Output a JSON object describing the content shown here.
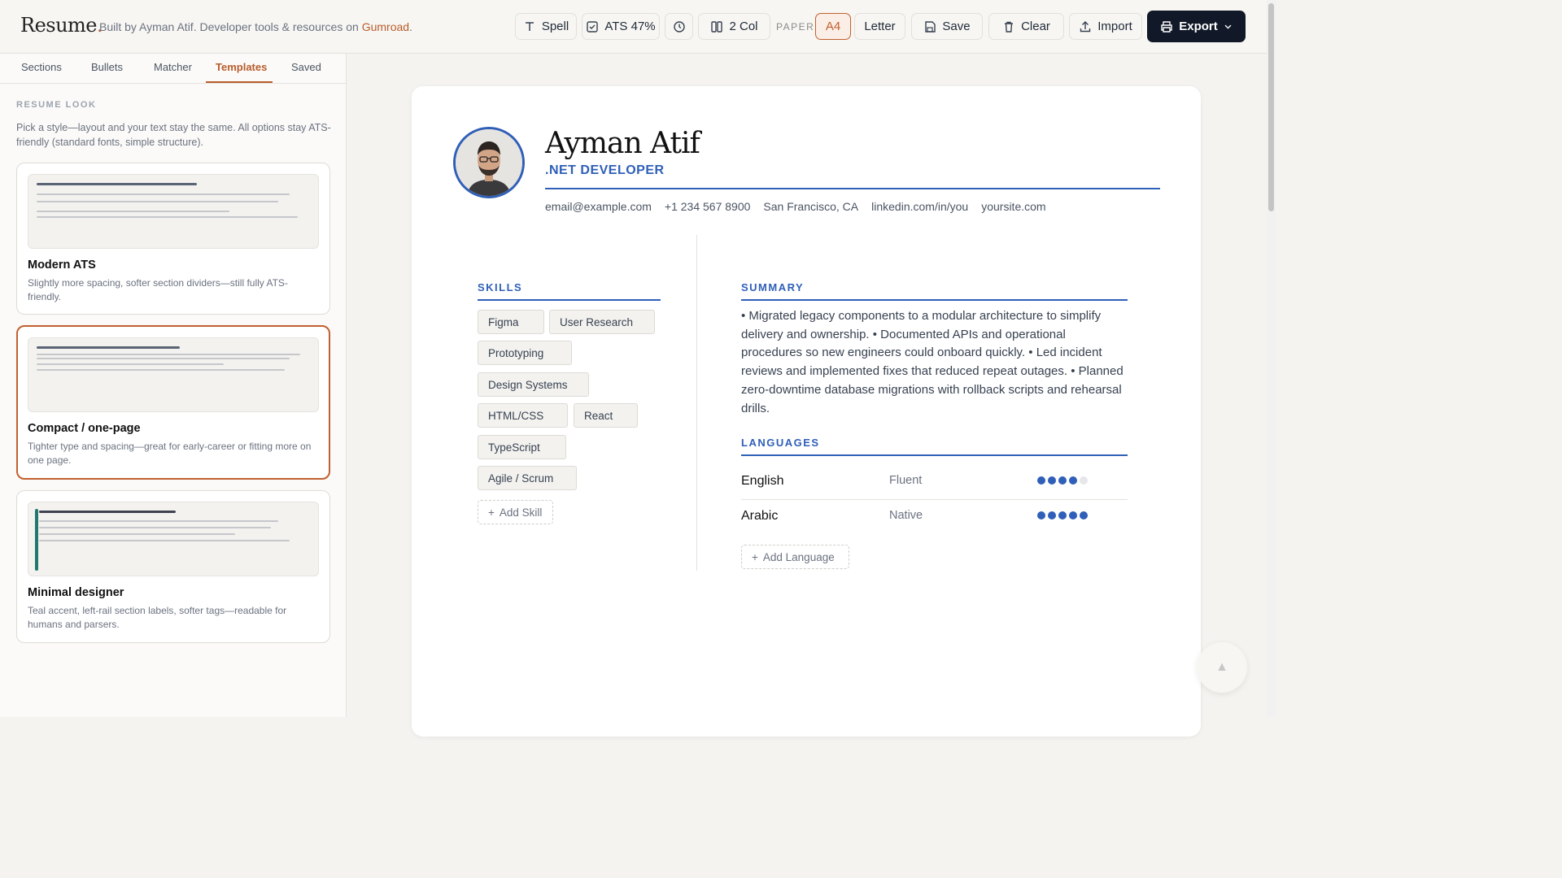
{
  "app": {
    "logo": "Resume",
    "logo_dot": ".",
    "tagline_prefix": "Built by Ayman Atif. Developer tools & resources on ",
    "tagline_link": "Gumroad",
    "tagline_suffix": "."
  },
  "toolbar": {
    "spell": "Spell",
    "ats": "ATS 47%",
    "columns": "2 Col",
    "paper_label": "PAPER",
    "paper_a4": "A4",
    "paper_letter": "Letter",
    "save": "Save",
    "clear": "Clear",
    "import": "Import",
    "export": "Export"
  },
  "sidebar": {
    "tabs": [
      {
        "label": "Sections"
      },
      {
        "label": "Bullets"
      },
      {
        "label": "Matcher"
      },
      {
        "label": "Templates"
      },
      {
        "label": "Saved"
      }
    ],
    "active_tab": "Templates",
    "section_label": "RESUME LOOK",
    "section_desc": "Pick a style—layout and your text stay the same. All options stay ATS-friendly (standard fonts, simple structure).",
    "templates": [
      {
        "title": "Modern ATS",
        "desc": "Slightly more spacing, softer section dividers—still fully ATS-friendly.",
        "selected": false
      },
      {
        "title": "Compact / one-page",
        "desc": "Tighter type and spacing—great for early-career or fitting more on one page.",
        "selected": true
      },
      {
        "title": "Minimal designer",
        "desc": "Teal accent, left-rail section labels, softer tags—readable for humans and parsers.",
        "selected": false
      }
    ]
  },
  "resume": {
    "name": "Ayman Atif",
    "role": ".NET DEVELOPER",
    "contacts": [
      "email@example.com",
      "+1 234 567 8900",
      "San Francisco, CA",
      "linkedin.com/in/you",
      "yoursite.com"
    ],
    "skills_heading": "SKILLS",
    "skills": [
      "Figma",
      "User Research",
      "Prototyping",
      "Design Systems",
      "HTML/CSS",
      "React",
      "TypeScript",
      "Agile / Scrum"
    ],
    "add_skill": "Add Skill",
    "summary_heading": "SUMMARY",
    "summary": "• Migrated legacy components to a modular architecture to simplify delivery and ownership. • Documented APIs and operational procedures so new engineers could onboard quickly. • Led incident reviews and implemented fixes that reduced repeat outages. • Planned zero-downtime database migrations with rollback scripts and rehearsal drills.",
    "languages_heading": "LANGUAGES",
    "languages": [
      {
        "name": "English",
        "level": "Fluent",
        "rating": 4,
        "max": 5
      },
      {
        "name": "Arabic",
        "level": "Native",
        "rating": 5,
        "max": 5
      }
    ],
    "add_language": "Add Language"
  },
  "colors": {
    "accent_brand": "#b85c2b",
    "resume_accent": "#2f5fb8",
    "export_bg": "#111827"
  }
}
